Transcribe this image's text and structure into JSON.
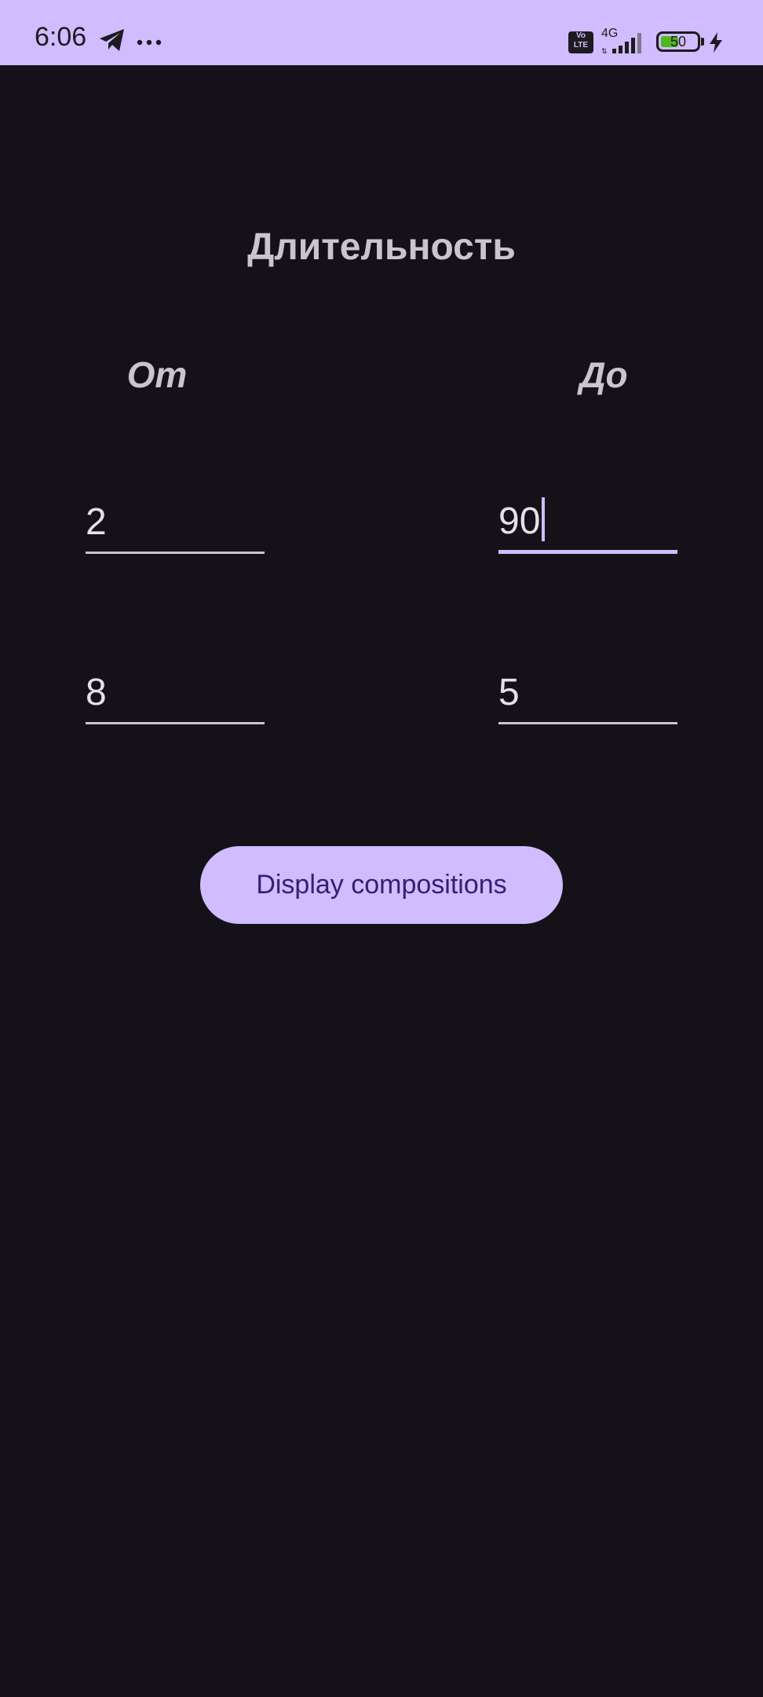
{
  "status_bar": {
    "time": "6:06",
    "network_type": "4G",
    "volte_top": "Vo",
    "volte_bottom": "LTE",
    "battery_level": "50",
    "battery_fraction": 0.5,
    "icons": [
      "telegram-icon",
      "more-icon",
      "volte-icon",
      "signal-icon",
      "battery-icon",
      "charging-icon"
    ],
    "background_color": "#D0BCFF"
  },
  "main": {
    "title": "Длительность",
    "from_label": "От",
    "to_label": "До",
    "rows": [
      {
        "from_value": "2",
        "to_value": "90"
      },
      {
        "from_value": "8",
        "to_value": "5"
      }
    ],
    "focused_field": "to_value_row_1"
  },
  "actions": {
    "display_button_label": "Display compositions"
  },
  "colors": {
    "background": "#141218",
    "accent": "#D0BCFF",
    "button_text": "#381E72",
    "label_text": "#CAC4D0",
    "value_text": "#E6E0E9"
  }
}
